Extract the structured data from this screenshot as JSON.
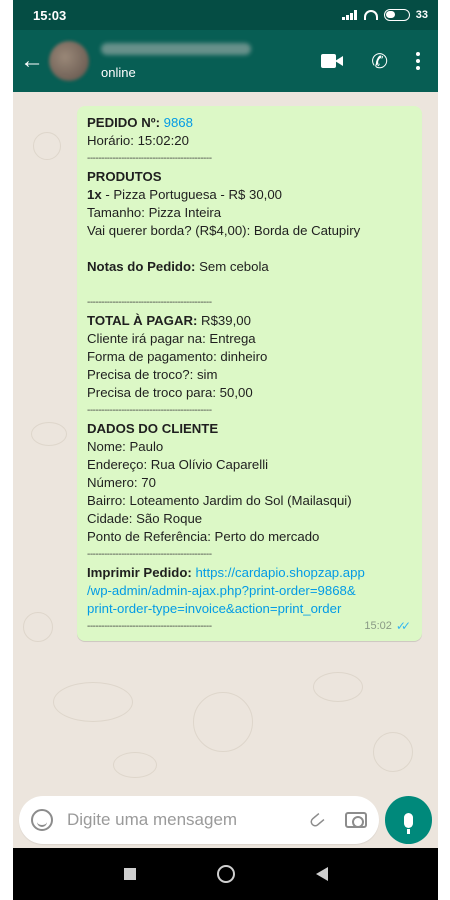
{
  "status_bar": {
    "time": "15:03",
    "battery": "33"
  },
  "header": {
    "contact_status": "online"
  },
  "message": {
    "order_label": "PEDIDO Nº:",
    "order_number": "9868",
    "time_line": "Horário: 15:02:20",
    "separator": "--------------------------------------------",
    "products_title": "PRODUTOS",
    "product_qty": "1x",
    "product_line": " - Pizza Portuguesa - R$ 30,00",
    "size_line": "Tamanho: Pizza Inteira",
    "border_line": "Vai querer borda? (R$4,00): Borda de Catupiry",
    "notes_label": "Notas do Pedido:",
    "notes_value": " Sem cebola",
    "total_label": "TOTAL À PAGAR:",
    "total_value": " R$39,00",
    "pay_line1": "Cliente irá pagar na: Entrega",
    "pay_line2": "Forma de pagamento: dinheiro",
    "pay_line3": "Precisa de troco?: sim",
    "pay_line4": "Precisa de troco para: 50,00",
    "client_title": "DADOS DO CLIENTE",
    "client_name": "Nome: Paulo",
    "client_address": "Endereço: Rua Olívio Caparelli",
    "client_number": "Número: 70",
    "client_district": "Bairro: Loteamento Jardim do Sol (Mailasqui)",
    "client_city": "Cidade: São Roque",
    "client_reference": "Ponto de Referência: Perto do mercado",
    "print_label": "Imprimir Pedido:",
    "print_link_1": " https://cardapio.shopzap.app",
    "print_link_2": "/wp-admin/admin-ajax.php?print-order=9868&",
    "print_link_3": "print-order-type=invoice&action=print_order",
    "timestamp": "15:02",
    "tick_icon": "double-check-icon"
  },
  "input": {
    "placeholder": "Digite uma mensagem"
  },
  "colors": {
    "header": "#075e54",
    "status_bar": "#054d44",
    "bubble": "#dcf8c6",
    "chat_bg": "#ece5dd",
    "accent": "#00897b",
    "link": "#039be5"
  }
}
